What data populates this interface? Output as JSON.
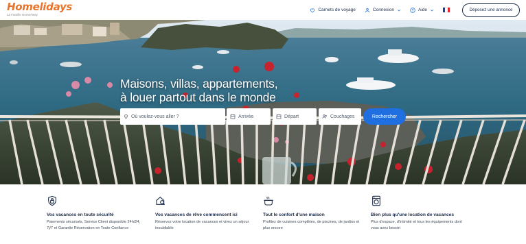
{
  "brand": {
    "name": "Homelidays",
    "tagline": "La Famille HomeAway"
  },
  "nav": {
    "favorites_label": "Carnets de voyage",
    "login_label": "Connexion",
    "help_label": "Aide",
    "language": "fr",
    "cta_label": "Déposez une annonce"
  },
  "hero": {
    "title_line1": "Maisons, villas, appartements,",
    "title_line2": "à louer partout dans le monde"
  },
  "search": {
    "destination_placeholder": "Où voulez-vous aller ?",
    "arrival_placeholder": "Arrivée",
    "departure_placeholder": "Départ",
    "guests_placeholder": "Couchages",
    "submit_label": "Rechercher"
  },
  "features": [
    {
      "icon": "lock-shield-icon",
      "title": "Vos vacances en toute sécurité",
      "desc_line1": "Paiements sécurisés, Service Client disponible 24h/24,",
      "desc_line2": "7j/7 et Garantie Réservation en Toute Confiance"
    },
    {
      "icon": "house-search-icon",
      "title": "Vos vacances de rêve commencent ici",
      "desc_line1": "Réservez votre location de vacances et vivez un séjour",
      "desc_line2": "inoubliable"
    },
    {
      "icon": "cooking-pot-icon",
      "title": "Tout le confort d'une maison",
      "desc_line1": "Profitez de cuisines complètes, de piscines, de jardins et",
      "desc_line2": "plus encore"
    },
    {
      "icon": "washing-machine-icon",
      "title": "Bien plus qu'une location de vacances",
      "desc_line1": "Plus d'espace, d'intimité et tous les équipements dont",
      "desc_line2": "vous avez besoin"
    }
  ],
  "colors": {
    "brand": "#e8742c",
    "accent": "#1f6fe0",
    "text": "#1a2b49"
  }
}
